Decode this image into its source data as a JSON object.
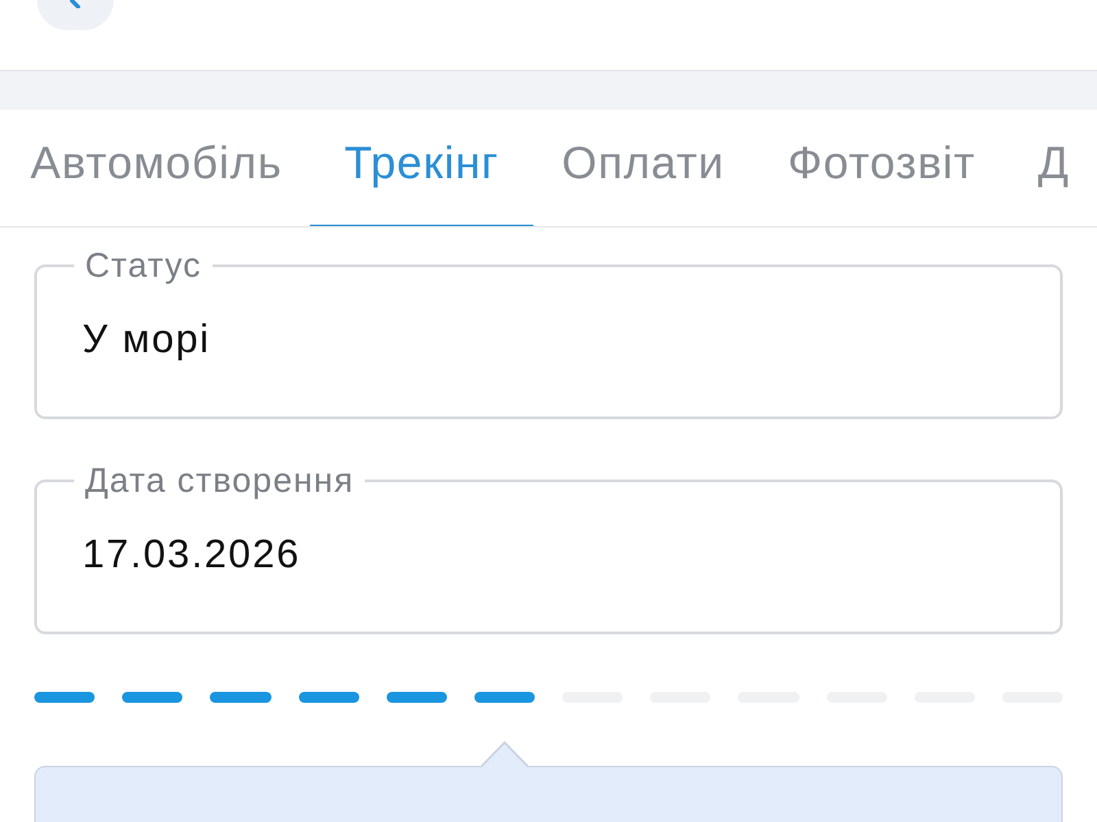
{
  "tabs": [
    {
      "label": "Автомобіль",
      "selected": false
    },
    {
      "label": "Трекінг",
      "selected": true
    },
    {
      "label": "Оплати",
      "selected": false
    },
    {
      "label": "Фотозвіт",
      "selected": false
    },
    {
      "label": "Д",
      "selected": false
    }
  ],
  "fields": [
    {
      "label": "Статус",
      "value": "У морі"
    },
    {
      "label": "Дата створення",
      "value": "17.03.2026"
    }
  ],
  "progress": {
    "steps": [
      {
        "done": true
      },
      {
        "done": true
      },
      {
        "done": true
      },
      {
        "done": true
      },
      {
        "done": true
      },
      {
        "done": true
      },
      {
        "done": false
      },
      {
        "done": false
      },
      {
        "done": false
      },
      {
        "done": false
      },
      {
        "done": false
      },
      {
        "done": false
      }
    ]
  }
}
